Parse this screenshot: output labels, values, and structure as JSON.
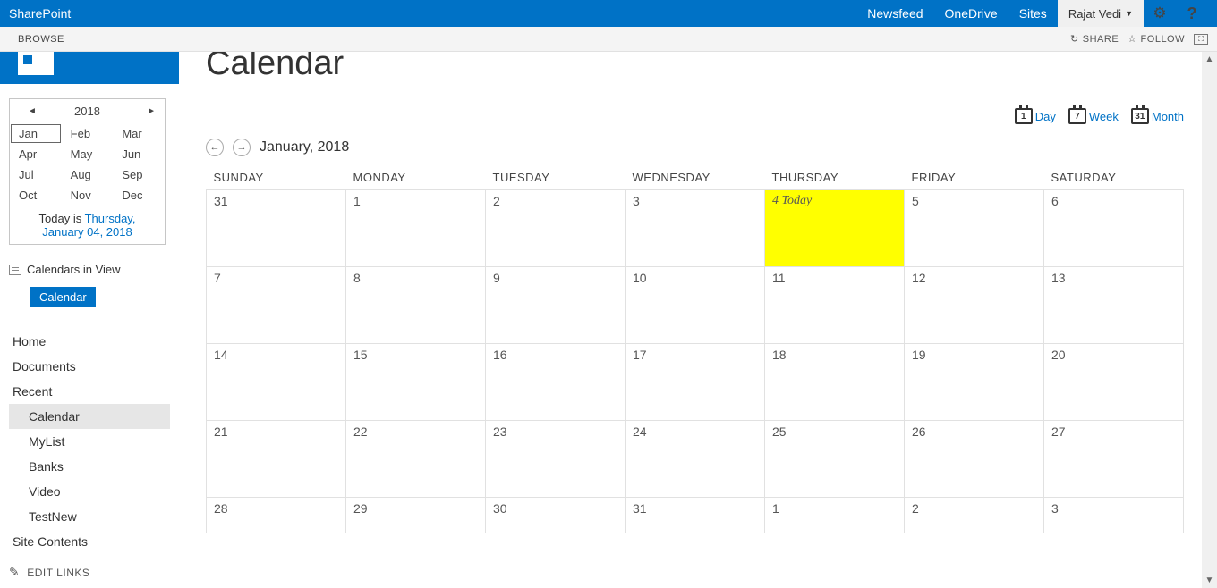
{
  "suite": {
    "brand": "SharePoint",
    "links": [
      "Newsfeed",
      "OneDrive",
      "Sites"
    ],
    "user": "Rajat Vedi"
  },
  "ribbon": {
    "tab": "BROWSE",
    "share": "SHARE",
    "follow": "FOLLOW"
  },
  "page_title": "Calendar",
  "mini": {
    "year": "2018",
    "months": [
      "Jan",
      "Feb",
      "Mar",
      "Apr",
      "May",
      "Jun",
      "Jul",
      "Aug",
      "Sep",
      "Oct",
      "Nov",
      "Dec"
    ],
    "selected": "Jan",
    "today_prefix": "Today is ",
    "today_link": "Thursday, January 04, 2018"
  },
  "civ": {
    "label": "Calendars in View",
    "chip": "Calendar"
  },
  "nav": {
    "items": [
      "Home",
      "Documents",
      "Recent"
    ],
    "subs": [
      "Calendar",
      "MyList",
      "Banks",
      "Video",
      "TestNew"
    ],
    "site_contents": "Site Contents",
    "edit": "EDIT LINKS"
  },
  "views": {
    "day": "Day",
    "week": "Week",
    "month": "Month",
    "day_n": "1",
    "week_n": "7",
    "month_n": "31"
  },
  "month_header": "January, 2018",
  "dow": [
    "SUNDAY",
    "MONDAY",
    "TUESDAY",
    "WEDNESDAY",
    "THURSDAY",
    "FRIDAY",
    "SATURDAY"
  ],
  "grid": {
    "r1": [
      "31",
      "1",
      "2",
      "3",
      "",
      "5",
      "6"
    ],
    "r2": [
      "7",
      "8",
      "9",
      "10",
      "11",
      "12",
      "13"
    ],
    "r3": [
      "14",
      "15",
      "16",
      "17",
      "18",
      "19",
      "20"
    ],
    "r4": [
      "21",
      "22",
      "23",
      "24",
      "25",
      "26",
      "27"
    ],
    "r5": [
      "28",
      "29",
      "30",
      "31",
      "1",
      "2",
      "3"
    ],
    "today_num": "4",
    "today_label": " Today"
  }
}
